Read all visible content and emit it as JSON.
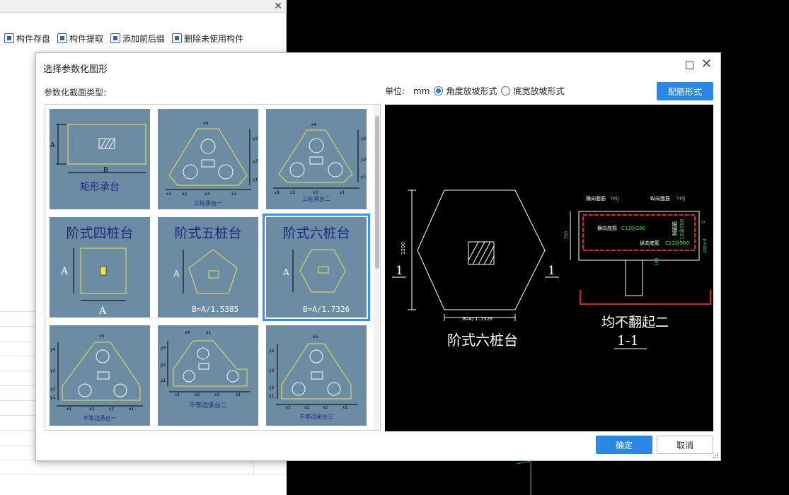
{
  "background_app": {
    "toolbar": [
      {
        "label": "构件存盘",
        "icon": "save-component-icon"
      },
      {
        "label": "构件提取",
        "icon": "extract-component-icon"
      },
      {
        "label": "添加前后缀",
        "icon": "add-affix-icon"
      },
      {
        "label": "删除未使用构件",
        "icon": "delete-unused-icon"
      }
    ],
    "close_glyph": "✕"
  },
  "dialog": {
    "title": "选择参数化图形",
    "section_label": "参数化截面类型:",
    "unit_label": "单位:",
    "unit_value": "mm",
    "options": [
      {
        "label": "角度放坡形式",
        "checked": true
      },
      {
        "label": "底宽放坡形式",
        "checked": false
      }
    ],
    "rebar_button": "配筋形式",
    "ok_button": "确定",
    "cancel_button": "取消",
    "close_glyph": "✕"
  },
  "thumbnails": [
    {
      "name": "矩形承台",
      "dim1": "A",
      "dim2": "B",
      "selected": false
    },
    {
      "name": "三桩承台一",
      "labels": [
        "x4",
        "y3",
        "y2",
        "y1",
        "x1",
        "x2",
        "x3",
        "x1"
      ],
      "selected": false
    },
    {
      "name": "三桩承台二",
      "labels": [
        "x4",
        "y3",
        "y2",
        "y1",
        "x1",
        "x2",
        "x3",
        "x1"
      ],
      "selected": false
    },
    {
      "name": "阶式四桩台",
      "dim1": "A",
      "dim2": "A",
      "selected": false
    },
    {
      "name": "阶式五桩台",
      "dim1": "A",
      "formula": "B=A/1.5385",
      "selected": false
    },
    {
      "name": "阶式六桩台",
      "dim1": "A",
      "formula": "B=A/1.7326",
      "selected": true
    },
    {
      "name": "不等边承台一",
      "labels": [
        "x5",
        "y4",
        "y3",
        "y2",
        "y1",
        "x1",
        "x2",
        "x2",
        "x1"
      ],
      "selected": false
    },
    {
      "name": "不等边承台二",
      "labels": [
        "x4",
        "x1",
        "y3",
        "y2",
        "y1",
        "x1",
        "x2",
        "x3",
        "x1"
      ],
      "selected": false
    },
    {
      "name": "不等边承台三",
      "labels": [
        "x5",
        "y4",
        "y3",
        "y2",
        "y1",
        "x1",
        "x2",
        "x2",
        "x1"
      ],
      "selected": false
    }
  ],
  "preview": {
    "plan_title": "阶式六桩台",
    "height_dim": "1200",
    "width_dim": "B=A/1.7326",
    "section_mark": "1",
    "section_title": "均不翻起二",
    "section_name": "1-1",
    "section_labels": {
      "top_transverse": "横向面筋",
      "top_transverse_code": "YMJ",
      "top_longitudinal": "纵向面筋",
      "top_longitudinal_code": "YMJ",
      "bottom_transverse": "横向底筋",
      "bottom_transverse_spec": "C12@200",
      "bottom_longitudinal": "纵向底筋",
      "bottom_longitudinal_spec": "C12@200",
      "side_rebar": "侧面筋",
      "side_rebar_spec": "C12@200",
      "depth_dim": "500",
      "cover_top": "0",
      "cover_bottom": "100+d",
      "pile_dim": "100"
    },
    "colors": {
      "line": "#ffffff",
      "rebar": "#e0211c",
      "annotation": "#33e633",
      "hatch_fill": "#f0e24a"
    }
  }
}
